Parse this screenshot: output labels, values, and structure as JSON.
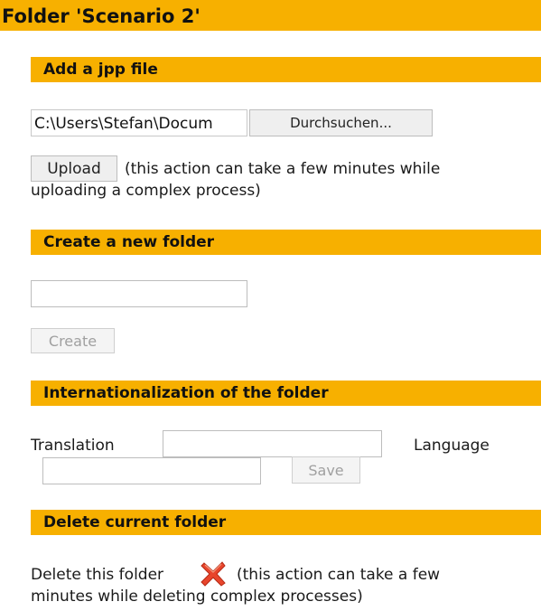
{
  "page": {
    "title": "Folder 'Scenario 2'"
  },
  "upload_section": {
    "heading": "Add a jpp file",
    "file_path": "C:\\Users\\Stefan\\Docum",
    "browse_label": "Durchsuchen...",
    "upload_label": "Upload",
    "upload_note": "(this action can take a few minutes while uploading a complex process)"
  },
  "new_folder_section": {
    "heading": "Create a new folder",
    "folder_name_value": "",
    "create_label": "Create"
  },
  "i18n_section": {
    "heading": "Internationalization of the folder",
    "translation_label": "Translation",
    "translation_value": "",
    "language_label": "Language",
    "language_value": "",
    "save_label": "Save"
  },
  "delete_section": {
    "heading": "Delete current folder",
    "delete_label": "Delete this folder",
    "delete_icon": "red-x-icon",
    "delete_note": "(this action can take a few minutes while deleting complex processes)"
  },
  "colors": {
    "accent": "#f7b000",
    "delete_icon": "#e8452c"
  }
}
